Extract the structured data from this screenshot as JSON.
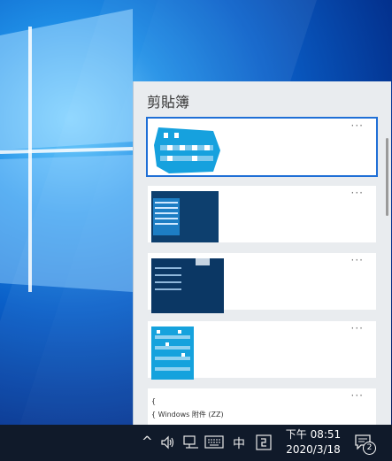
{
  "clipboard": {
    "title": "剪貼簿",
    "more_label": "···",
    "items": [
      {
        "kind": "image",
        "desc": "highlighted icons"
      },
      {
        "kind": "image",
        "desc": "screenshot"
      },
      {
        "kind": "image",
        "desc": "screenshot"
      },
      {
        "kind": "image",
        "desc": "icons"
      },
      {
        "kind": "text",
        "line1": "{",
        "line2": "{ Windows 附件 (ZZ)"
      }
    ]
  },
  "taskbar": {
    "chevron_icon": "^",
    "ime_label": "中",
    "time": "下午 08:51",
    "date": "2020/3/18",
    "notification_count": "2"
  },
  "colors": {
    "accent": "#1f6fd6",
    "taskbar": "#101a2a",
    "panel": "#e9ecef"
  }
}
